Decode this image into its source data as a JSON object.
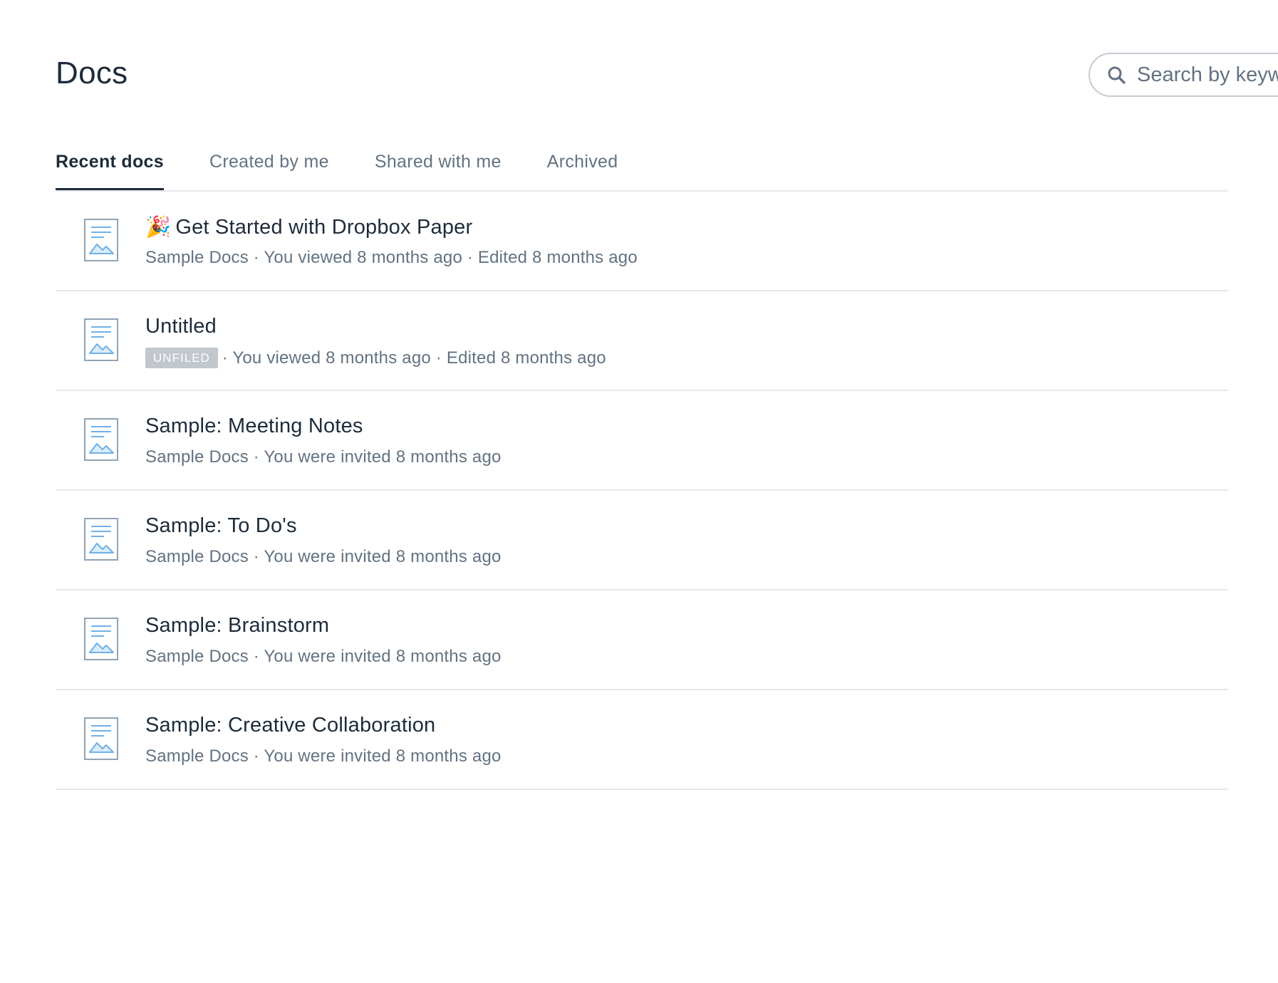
{
  "header": {
    "title": "Docs"
  },
  "search": {
    "placeholder": "Search by keyword"
  },
  "tabs": [
    {
      "label": "Recent docs",
      "active": true
    },
    {
      "label": "Created by me",
      "active": false
    },
    {
      "label": "Shared with me",
      "active": false
    },
    {
      "label": "Archived",
      "active": false
    }
  ],
  "docs": [
    {
      "emoji": "🎉",
      "title": "Get Started with Dropbox Paper",
      "meta": "Sample Docs · You viewed 8 months ago · Edited 8 months ago"
    },
    {
      "title": "Untitled",
      "badge": "UNFILED",
      "meta": "· You viewed 8 months ago · Edited 8 months ago"
    },
    {
      "title": "Sample: Meeting Notes",
      "meta": "Sample Docs · You were invited 8 months ago"
    },
    {
      "title": "Sample: To Do's",
      "meta": "Sample Docs · You were invited 8 months ago"
    },
    {
      "title": "Sample: Brainstorm",
      "meta": "Sample Docs · You were invited 8 months ago"
    },
    {
      "title": "Sample: Creative Collaboration",
      "meta": "Sample Docs · You were invited 8 months ago"
    }
  ],
  "icons": {
    "search": "search-icon",
    "doc": "document-icon"
  },
  "colors": {
    "text": "#1e2b3a",
    "muted": "#637282",
    "divider": "#e6e8eb",
    "doc_icon_blue": "#6fb0e6",
    "badge_bg": "#c1c7cd"
  }
}
